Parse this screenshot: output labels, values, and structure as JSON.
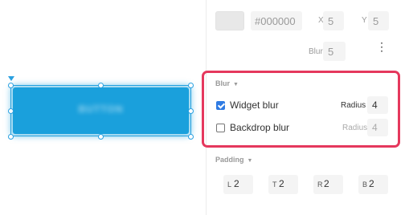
{
  "canvas": {
    "widget_text": "BUTTON"
  },
  "shadow": {
    "color_hex": "#000000",
    "x_label": "X",
    "x_value": "5",
    "y_label": "Y",
    "y_value": "5",
    "blur_label": "Blur",
    "blur_value": "5",
    "more_icon": "⋮"
  },
  "blur_section": {
    "title": "Blur",
    "caret": "▼",
    "widget_blur": {
      "label": "Widget blur",
      "checked": true,
      "radius_label": "Radius",
      "radius_value": "4"
    },
    "backdrop_blur": {
      "label": "Backdrop blur",
      "checked": false,
      "radius_label": "Radius",
      "radius_value": "4"
    }
  },
  "padding": {
    "title": "Padding",
    "caret": "▼",
    "fields": [
      {
        "letter": "L",
        "value": "2"
      },
      {
        "letter": "T",
        "value": "2"
      },
      {
        "letter": "R",
        "value": "2"
      },
      {
        "letter": "B",
        "value": "2"
      }
    ]
  },
  "colors": {
    "highlight": "#e5385d",
    "selection": "#2aa0e0",
    "widget": "#1aa0dc",
    "checkbox": "#2f7be3"
  }
}
